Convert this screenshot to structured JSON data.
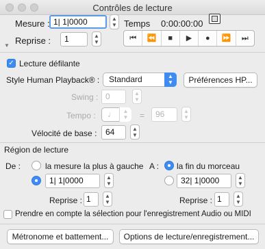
{
  "window": {
    "title": "Contrôles de lecture"
  },
  "header": {
    "measure_label": "Mesure :",
    "measure_value": "1| 1|0000",
    "time_label": "Temps",
    "time_value": "0:00:00:00",
    "repeat_label": "Reprise :",
    "repeat_value": "1"
  },
  "transport": {
    "rewind_start": "⏮",
    "rewind": "⏪",
    "stop": "■",
    "play": "▶",
    "record": "●",
    "forward": "⏩",
    "forward_end": "⏭"
  },
  "options": {
    "scroll_label": "Lecture défilante",
    "scroll_checked": true,
    "human_style_label": "Style Human Playback® :",
    "human_style_value": "Standard",
    "human_prefs_button": "Préférences HP...",
    "swing_label": "Swing :",
    "swing_value": "0",
    "tempo_label": "Tempo :",
    "tempo_equals": "=",
    "tempo_value": "96",
    "velocity_label": "Vélocité de base :",
    "velocity_value": "64"
  },
  "region": {
    "section_label": "Région de lecture",
    "from_label": "De :",
    "from_leftmost_label": "la mesure la plus à gauche",
    "from_value": "1| 1|0000",
    "to_label": "A :",
    "to_end_label": "la fin du morceau",
    "to_value": "32| 1|0000",
    "from_repeat_label": "Reprise :",
    "from_repeat_value": "1",
    "to_repeat_label": "Reprise :",
    "to_repeat_value": "1",
    "consider_selection_label": "Prendre en compte la sélection pour l'enregistrement Audio ou MIDI",
    "consider_selection_checked": false
  },
  "footer": {
    "metronome_button": "Métronome et battement...",
    "playback_options_button": "Options de lecture/enregistrement..."
  },
  "colors": {
    "accent": "#3e8bf2",
    "background": "#ececec"
  }
}
